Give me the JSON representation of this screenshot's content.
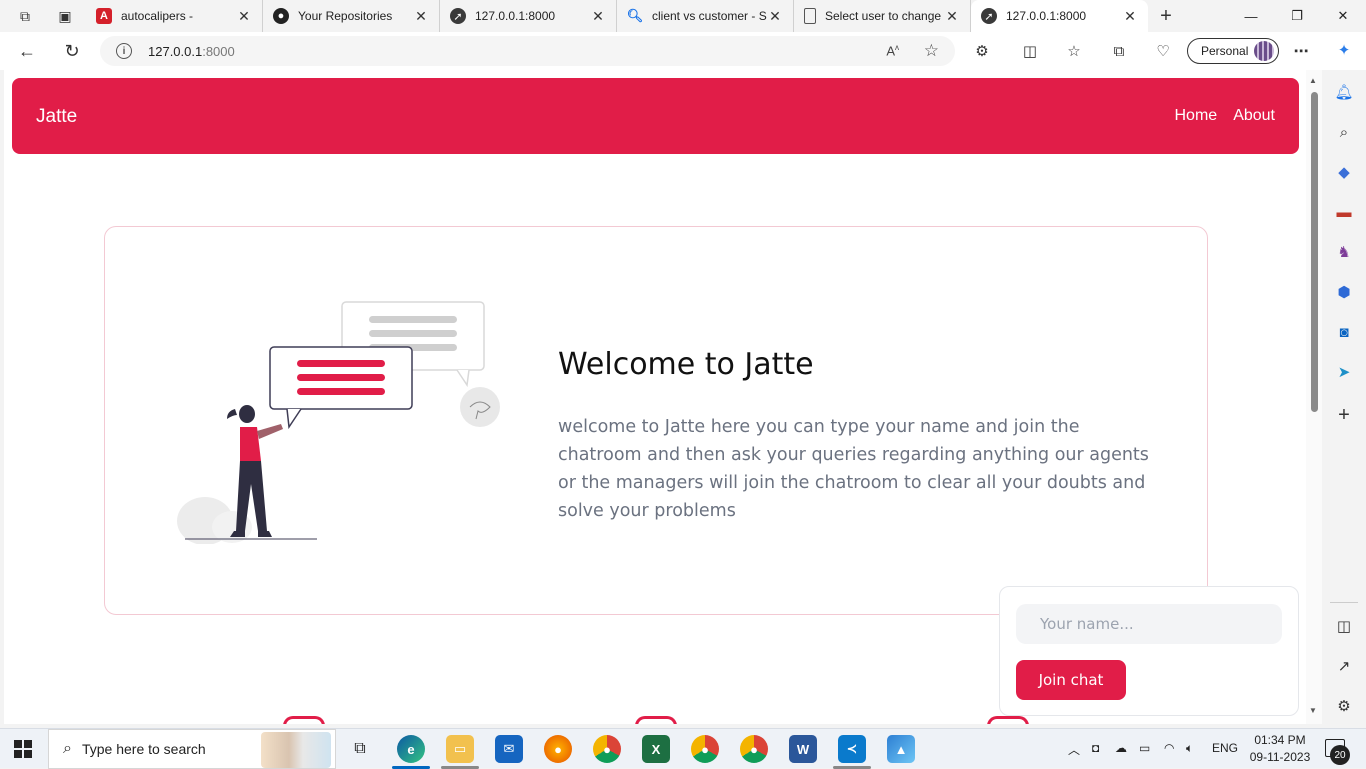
{
  "browser": {
    "tabs": [
      {
        "title": "autocalipers -",
        "icon": "adobe-acrobat-icon",
        "color": "#d4202a"
      },
      {
        "title": "Your Repositories",
        "icon": "github-icon",
        "color": "#222222"
      },
      {
        "title": "127.0.0.1:8000",
        "icon": "rocket-icon",
        "color": "#3a3a3a"
      },
      {
        "title": "client vs customer - S",
        "icon": "search-icon",
        "color": "#1a73e8"
      },
      {
        "title": "Select user to change",
        "icon": "page-icon",
        "color": "#555555"
      },
      {
        "title": "127.0.0.1:8000",
        "icon": "rocket-icon",
        "color": "#3a3a3a"
      }
    ],
    "url_host": "127.0.0.1",
    "url_port": ":8000",
    "profile_label": "Personal"
  },
  "site": {
    "brand": "Jatte",
    "nav": [
      "Home",
      "About"
    ],
    "welcome_title": "Welcome to Jatte",
    "welcome_text": "welcome to Jatte here you can type your name and join the chatroom and then ask your queries regarding anything our agents or the managers will join the chatroom to clear all your doubts and solve your problems",
    "accent": "#e11d48",
    "chat": {
      "name_placeholder": "Your name...",
      "join_label": "Join chat"
    }
  },
  "taskbar": {
    "search_placeholder": "Type here to search",
    "language": "ENG",
    "time": "01:34 PM",
    "date": "09-11-2023",
    "notifications": "20"
  }
}
